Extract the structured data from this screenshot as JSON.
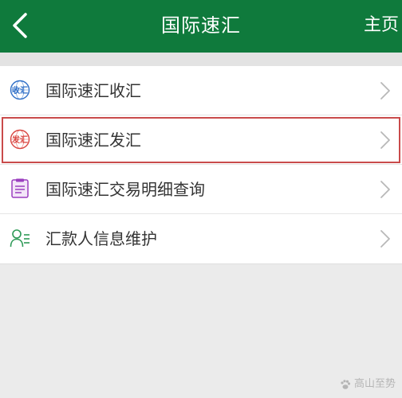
{
  "header": {
    "title": "国际速汇",
    "home_label": "主页"
  },
  "menu": {
    "items": [
      {
        "label": "国际速汇收汇",
        "icon": "receive-remittance-icon",
        "icon_text": "收汇",
        "icon_color": "#2f6fc7"
      },
      {
        "label": "国际速汇发汇",
        "icon": "send-remittance-icon",
        "icon_text": "发汇",
        "icon_color": "#d9443f"
      },
      {
        "label": "国际速汇交易明细查询",
        "icon": "transaction-list-icon",
        "icon_color": "#9b3fbf"
      },
      {
        "label": "汇款人信息维护",
        "icon": "remitter-info-icon",
        "icon_color": "#2e9a57"
      }
    ]
  },
  "watermark": {
    "text": "高山至势"
  },
  "colors": {
    "header_bg": "#0f7a3c",
    "highlight_border": "#c94b4b",
    "background": "#ebebeb"
  }
}
